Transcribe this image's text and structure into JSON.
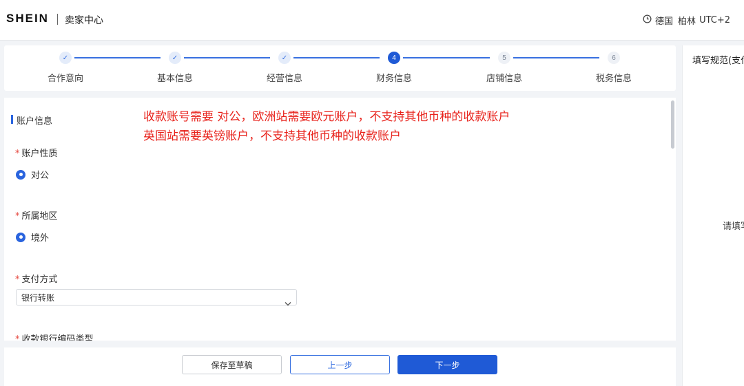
{
  "header": {
    "logo": "SHEIN",
    "title": "卖家中心",
    "timezone": {
      "icon": "clock-icon",
      "country": "德国",
      "city": "柏林",
      "offset": "UTC+2"
    }
  },
  "steps": [
    {
      "label": "合作意向",
      "status": "done",
      "marker": "✓"
    },
    {
      "label": "基本信息",
      "status": "done",
      "marker": "✓"
    },
    {
      "label": "经营信息",
      "status": "done",
      "marker": "✓"
    },
    {
      "label": "财务信息",
      "status": "active",
      "marker": "4"
    },
    {
      "label": "店铺信息",
      "status": "todo",
      "marker": "5"
    },
    {
      "label": "税务信息",
      "status": "todo",
      "marker": "6"
    }
  ],
  "side_panel": {
    "title": "填写规范(支付",
    "hint": "请填写"
  },
  "form": {
    "section_title": "账户信息",
    "annotation_line1": "收款账号需要 对公，欧洲站需要欧元账户，不支持其他币种的收款账户",
    "annotation_line2": "英国站需要英镑账户，不支持其他币种的收款账户",
    "required_mark": "*",
    "account_type": {
      "label": "账户性质",
      "selected": "对公"
    },
    "region": {
      "label": "所属地区",
      "selected": "境外"
    },
    "payment_method": {
      "label": "支付方式",
      "value": "银行转账"
    },
    "bank_code_type": {
      "label": "收款银行编码类型"
    }
  },
  "footer": {
    "save_draft": "保存至草稿",
    "prev": "上一步",
    "next": "下一步"
  },
  "colors": {
    "primary": "#1f5ad6",
    "annotation": "#e8231c",
    "required": "#e5463d"
  }
}
